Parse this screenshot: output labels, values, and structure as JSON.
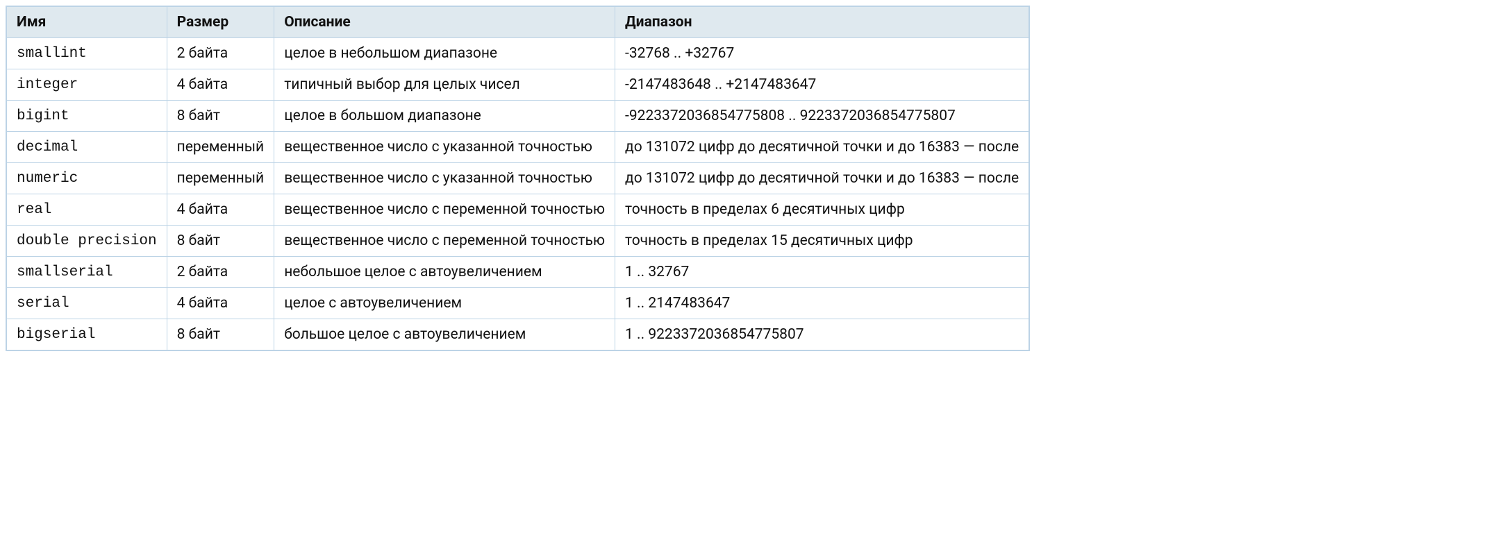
{
  "table": {
    "headers": [
      "Имя",
      "Размер",
      "Описание",
      "Диапазон"
    ],
    "rows": [
      {
        "name": "smallint",
        "size": "2 байта",
        "desc": "целое в небольшом диапазоне",
        "range": "-32768 .. +32767"
      },
      {
        "name": "integer",
        "size": "4 байта",
        "desc": "типичный выбор для целых чисел",
        "range": "-2147483648 .. +2147483647"
      },
      {
        "name": "bigint",
        "size": "8 байт",
        "desc": "целое в большом диапазоне",
        "range": "-9223372036854775808 .. 9223372036854775807"
      },
      {
        "name": "decimal",
        "size": "переменный",
        "desc": "вещественное число с указанной точностью",
        "range": "до 131072 цифр до десятичной точки и до 16383 — после"
      },
      {
        "name": "numeric",
        "size": "переменный",
        "desc": "вещественное число с указанной точностью",
        "range": "до 131072 цифр до десятичной точки и до 16383 — после"
      },
      {
        "name": "real",
        "size": "4 байта",
        "desc": "вещественное число с переменной точностью",
        "range": "точность в пределах 6 десятичных цифр"
      },
      {
        "name": "double precision",
        "size": "8 байт",
        "desc": "вещественное число с переменной точностью",
        "range": "точность в пределах 15 десятичных цифр"
      },
      {
        "name": "smallserial",
        "size": "2 байта",
        "desc": "небольшое целое с автоувеличением",
        "range": "1 .. 32767"
      },
      {
        "name": "serial",
        "size": "4 байта",
        "desc": "целое с автоувеличением",
        "range": "1 .. 2147483647"
      },
      {
        "name": "bigserial",
        "size": "8 байт",
        "desc": "большое целое с автоувеличением",
        "range": "1 .. 9223372036854775807"
      }
    ]
  }
}
